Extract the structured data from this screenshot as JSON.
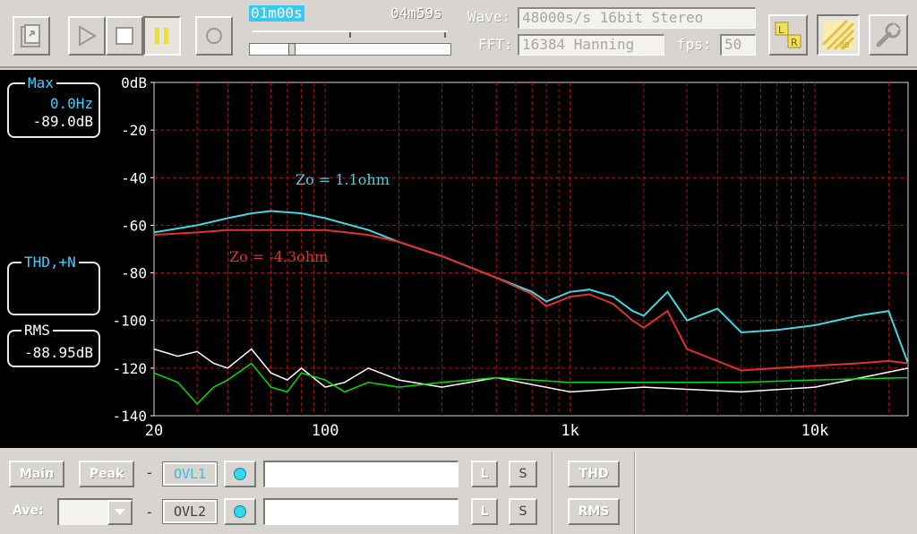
{
  "toolbar": {
    "time_current": "01m00s",
    "time_total": "04m59s",
    "wave_label": "Wave:",
    "wave_value": "48000s/s 16bit Stereo",
    "fft_label": "FFT:",
    "fft_value": "16384 Hanning",
    "fps_label": "fps:",
    "fps_value": "50",
    "progress": 0.2
  },
  "display": {
    "max_panel": {
      "title": "Max",
      "freq": "0.0Hz",
      "level": "-89.0dB"
    },
    "thd_panel": {
      "title": "THD,+N"
    },
    "rms_panel": {
      "title": "RMS",
      "level": "-88.95dB"
    }
  },
  "chart_data": {
    "type": "line",
    "xscale": "log",
    "xlim": [
      20,
      24000
    ],
    "ylim": [
      -140,
      0
    ],
    "x_ticks": [
      "20",
      "100",
      "1k",
      "10k"
    ],
    "y_ticks": [
      "0dB",
      "-20",
      "-40",
      "-60",
      "-80",
      "-100",
      "-120",
      "-140"
    ],
    "grid": true,
    "annotations": [
      {
        "text": "Zo = 1.1ohm",
        "color": "#40d8e0"
      },
      {
        "text": "Zo = -4.3ohm",
        "color": "#e03030"
      }
    ],
    "series": [
      {
        "color": "#40d8e0",
        "x": [
          20,
          30,
          40,
          50,
          60,
          80,
          100,
          150,
          200,
          300,
          500,
          700,
          800,
          1000,
          1200,
          1500,
          1800,
          2000,
          2500,
          3000,
          4000,
          5000,
          7000,
          10000,
          15000,
          20000,
          24000
        ],
        "y": [
          -63,
          -60,
          -57,
          -55,
          -54,
          -55,
          -57,
          -62,
          -67,
          -73,
          -82,
          -88,
          -92,
          -88,
          -87,
          -90,
          -96,
          -98,
          -88,
          -100,
          -95,
          -105,
          -104,
          -102,
          -98,
          -96,
          -118
        ]
      },
      {
        "color": "#e03030",
        "x": [
          20,
          30,
          40,
          50,
          60,
          80,
          100,
          150,
          200,
          300,
          500,
          700,
          800,
          1000,
          1200,
          1500,
          1800,
          2000,
          2500,
          3000,
          4000,
          5000,
          7000,
          10000,
          15000,
          20000,
          24000
        ],
        "y": [
          -64,
          -63,
          -62,
          -62,
          -62,
          -62,
          -62,
          -64,
          -67,
          -73,
          -82,
          -89,
          -94,
          -90,
          -89,
          -93,
          -100,
          -103,
          -96,
          -112,
          -117,
          -121,
          -120,
          -119,
          -118,
          -117,
          -118
        ]
      },
      {
        "color": "#ffffff",
        "x": [
          20,
          25,
          30,
          35,
          40,
          50,
          60,
          70,
          80,
          100,
          120,
          150,
          200,
          300,
          500,
          1000,
          2000,
          5000,
          10000,
          24000
        ],
        "y": [
          -112,
          -115,
          -113,
          -118,
          -120,
          -112,
          -122,
          -125,
          -120,
          -128,
          -126,
          -120,
          -125,
          -128,
          -124,
          -130,
          -128,
          -130,
          -128,
          -120
        ]
      },
      {
        "color": "#00e000",
        "x": [
          20,
          25,
          30,
          35,
          40,
          50,
          60,
          70,
          80,
          100,
          120,
          150,
          200,
          300,
          500,
          1000,
          2000,
          5000,
          10000,
          24000
        ],
        "y": [
          -122,
          -126,
          -135,
          -128,
          -125,
          -118,
          -128,
          -130,
          -122,
          -125,
          -130,
          -126,
          -128,
          -126,
          -124,
          -126,
          -126,
          -126,
          -125,
          -124
        ]
      }
    ]
  },
  "bottom": {
    "main_label": "Main",
    "peak_label": "Peak",
    "ave_label": "Ave:",
    "ovl1_label": "OVL1",
    "ovl2_label": "OVL2",
    "l_label": "L",
    "s_label": "S",
    "thd_label": "THD",
    "rms_label": "RMS",
    "dash": "-"
  }
}
